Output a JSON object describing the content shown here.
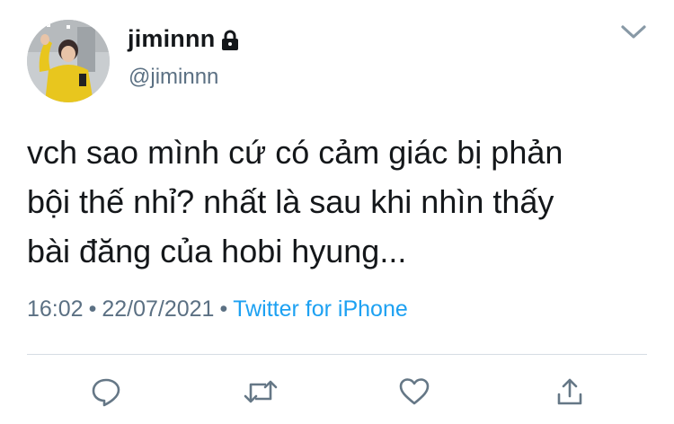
{
  "user": {
    "display_name": "jiminnn",
    "handle": "@jiminnn",
    "protected_icon": "lock-icon",
    "avatar": "profile-photo"
  },
  "tweet": {
    "text": "vch sao mình cứ có cảm giác bị phản\nbội thế nhỉ? nhất là sau khi nhìn thấy\nbài đăng của hobi hyung...",
    "time": "16:02",
    "separator": "•",
    "date": "22/07/2021",
    "source": "Twitter for iPhone"
  },
  "menu_icon": "chevron-down-icon",
  "actions": [
    "reply-icon",
    "retweet-icon",
    "like-icon",
    "share-icon"
  ],
  "colors": {
    "text": "#14171a",
    "secondary": "#5b7083",
    "link": "#1da1f2",
    "icon": "#657786",
    "divider": "#d6dde3"
  }
}
